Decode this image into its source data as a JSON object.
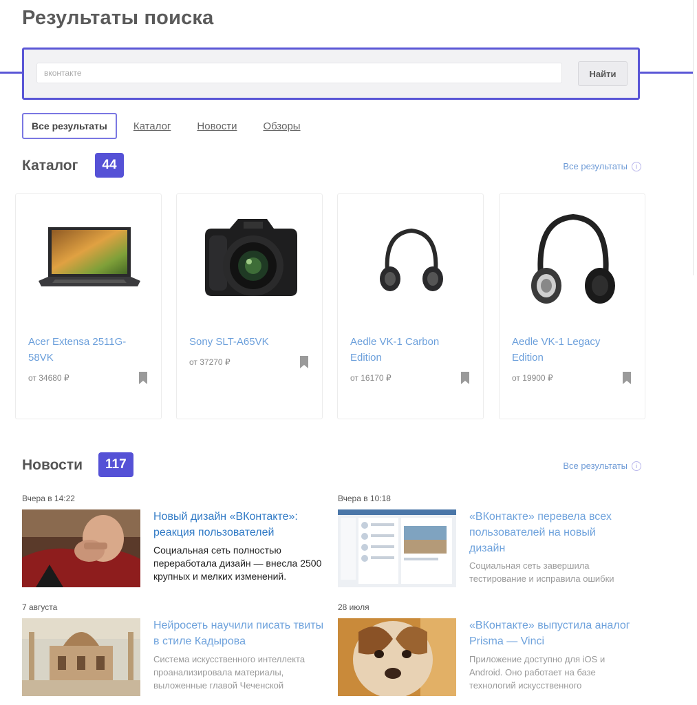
{
  "page": {
    "title": "Результаты поиска"
  },
  "search": {
    "placeholder": "вконтакте",
    "button_label": "Найти"
  },
  "tabs": [
    {
      "label": "Все результаты",
      "active": true
    },
    {
      "label": "Каталог"
    },
    {
      "label": "Новости"
    },
    {
      "label": "Обзоры"
    }
  ],
  "catalog": {
    "title": "Каталог",
    "count": "44",
    "all_label": "Все результаты",
    "products": [
      {
        "name": "Acer Extensa 2511G-58VK",
        "price": "от 34680 ₽",
        "image": "laptop"
      },
      {
        "name": "Sony SLT-A65VK",
        "price": "от 37270 ₽",
        "image": "camera"
      },
      {
        "name": "Aedle VK-1 Carbon Edition",
        "price": "от 16170 ₽",
        "image": "headphones"
      },
      {
        "name": "Aedle VK-1 Legacy Edition",
        "price": "от 19900 ₽",
        "image": "headphones"
      }
    ]
  },
  "news": {
    "title": "Новости",
    "count": "117",
    "all_label": "Все результаты",
    "items": [
      {
        "date": "Вчера в 14:22",
        "title": "Новый дизайн «ВКонтакте»: реакция пользователей",
        "description": "Социальная сеть полностью переработала дизайн — внесла 2500 крупных и мелких изменений.",
        "image": "facepalm-photo"
      },
      {
        "date": "Вчера в 10:18",
        "title": "«ВКонтакте» перевела всех пользователей на новый дизайн",
        "description": "Социальная сеть завершила тестирование и исправила ошибки",
        "image": "vk-screenshot"
      },
      {
        "date": "7 августа",
        "title": "Нейросеть научили писать твиты в стиле Кадырова",
        "description": "Система искусственного интеллекта проанализировала материалы, выложенные главой Чеченской",
        "image": "mosque-photo"
      },
      {
        "date": "28 июля",
        "title": "«ВКонтакте» выпустила аналог Prisma — Vinci",
        "description": "Приложение доступно для iOS и Android. Оно работает на базе технологий искусственного",
        "image": "dog-photo"
      }
    ]
  },
  "colors": {
    "accent": "#5551d6",
    "link": "#2f79c5",
    "soft_link": "#6b9fdb"
  }
}
